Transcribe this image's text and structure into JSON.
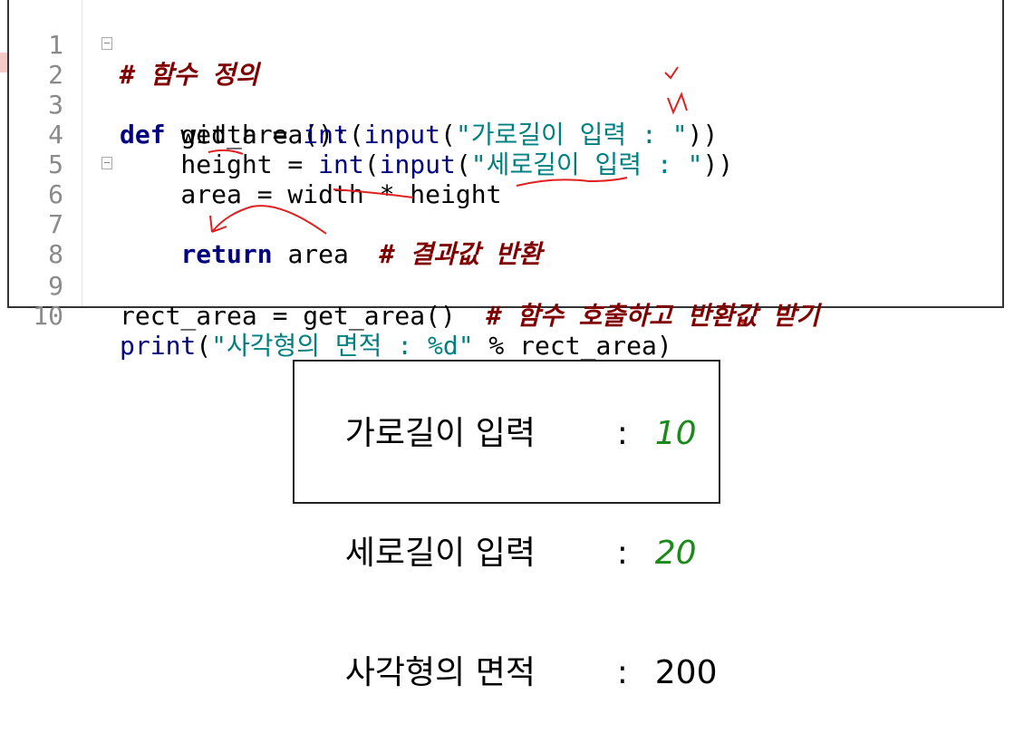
{
  "editor": {
    "lines": [
      {
        "no": "1",
        "code": "# 함수 정의"
      },
      {
        "no": "2",
        "code": "def get_area():"
      },
      {
        "no": "3",
        "code": "    width = int(input(\"가로길이 입력 : \"))"
      },
      {
        "no": "4",
        "code": "    height = int(input(\"세로길이 입력 : \"))"
      },
      {
        "no": "5",
        "code": "    area = width * height"
      },
      {
        "no": "6",
        "code": "    return area  # 결과값 반환"
      },
      {
        "no": "7",
        "code": ""
      },
      {
        "no": "8",
        "code": ""
      },
      {
        "no": "9",
        "code": "rect_area = get_area()  # 함수 호출하고 반환값 받기"
      },
      {
        "no": "10",
        "code": "print(\"사각형의 면적 : %d\" % rect_area)"
      }
    ],
    "tokens": {
      "l1_comment": "# 함수 정의",
      "l2_def": "def",
      "l2_rest": " get_area():",
      "l3_indent": "    width = ",
      "l3_int": "int",
      "l3_p1": "(",
      "l3_input": "input",
      "l3_p2": "(",
      "l3_str": "\"가로길이 입력 : \"",
      "l3_close": "))",
      "l4_indent": "    height = ",
      "l4_int": "int",
      "l4_p1": "(",
      "l4_input": "input",
      "l4_p2": "(",
      "l4_str": "\"세로길이 입력 : \"",
      "l4_close": "))",
      "l5_text": "    area = width * height",
      "l6_indent": "    ",
      "l6_return": "return",
      "l6_rest": " area  ",
      "l6_comment": "# 결과값 반환",
      "l9_text": "rect_area = get_area()  ",
      "l9_comment": "# 함수 호출하고 반환값 받기",
      "l10_print": "print",
      "l10_p1": "(",
      "l10_str": "\"사각형의 면적 : %d\"",
      "l10_rest": " % rect_area)"
    }
  },
  "output": {
    "lines": [
      {
        "label": "가로길이 입력",
        "colon": ":",
        "value": "10",
        "kind": "input"
      },
      {
        "label": "세로길이 입력",
        "colon": ":",
        "value": "20",
        "kind": "input"
      },
      {
        "label": "사각형의 면적",
        "colon": ":",
        "value": "200",
        "kind": "result"
      }
    ]
  },
  "colors": {
    "keyword": "#000080",
    "string": "#008080",
    "comment": "#800000",
    "input_value": "#1a8a1a",
    "annotation": "#e02020"
  }
}
